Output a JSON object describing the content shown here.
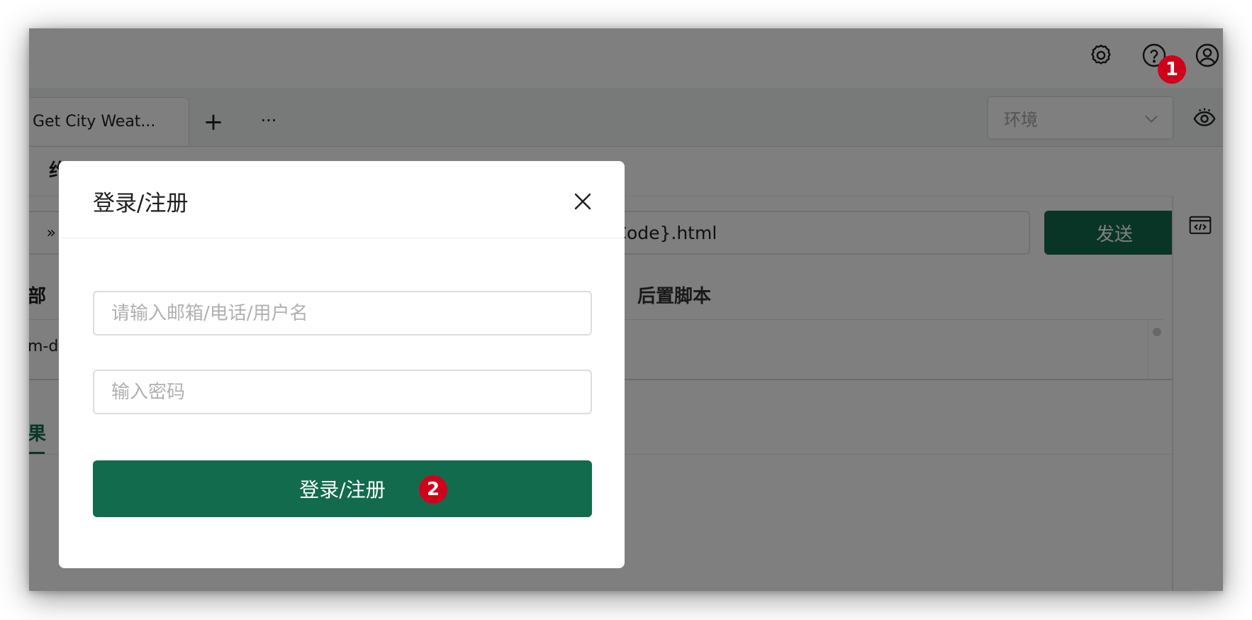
{
  "toolbar": {
    "icons": [
      "gear-icon",
      "help-icon",
      "user-icon"
    ]
  },
  "tabs": {
    "active_label": "Get City Weat...",
    "add_label": "+",
    "more_label": "···"
  },
  "environment": {
    "placeholder": "环境"
  },
  "request": {
    "subtab_label": "约",
    "method_fragment": "»",
    "url": "p/{cityCode}.html",
    "send_label": "发送",
    "tab_headers_fragment": "部",
    "tab_post_script": "后置脚本",
    "editor_text": "m-d"
  },
  "response": {
    "tab_fragment": "果"
  },
  "dialog": {
    "title": "登录/注册",
    "account_placeholder": "请输入邮箱/电话/用户名",
    "password_placeholder": "输入密码",
    "submit_label": "登录/注册"
  },
  "annotations": {
    "step1": "1",
    "step2": "2"
  },
  "colors": {
    "primary": "#136b4d",
    "badge": "#d0021b"
  }
}
